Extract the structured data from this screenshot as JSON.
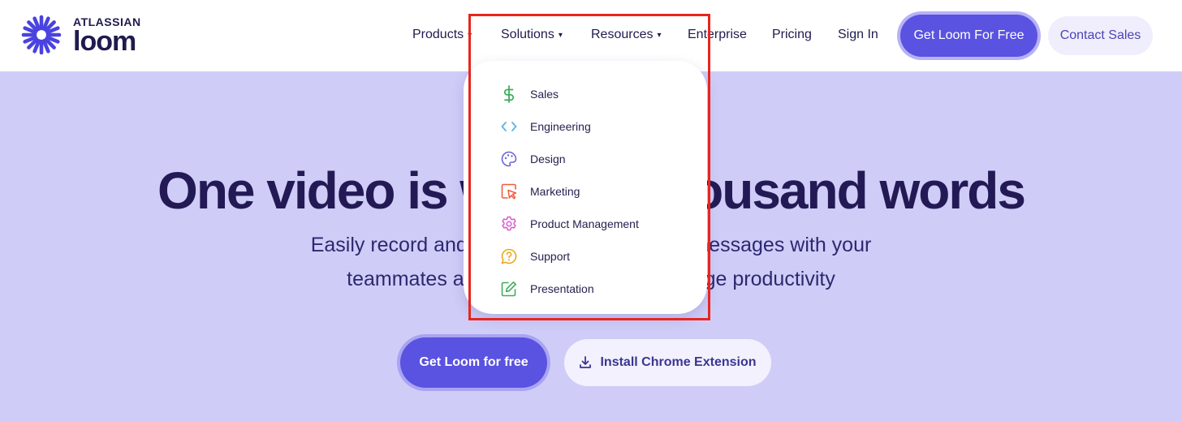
{
  "brand": {
    "atlassian": "ATLASSIAN",
    "name": "loom",
    "color": "#4a43e0"
  },
  "nav": {
    "products": "Products",
    "solutions": "Solutions",
    "resources": "Resources",
    "enterprise": "Enterprise",
    "pricing": "Pricing",
    "sign_in": "Sign In",
    "get_loom": "Get Loom For Free",
    "contact_sales": "Contact Sales",
    "caret": "▾"
  },
  "solutions_menu": {
    "items": [
      {
        "label": "Sales",
        "icon": "dollar-icon",
        "color": "#3fae5b"
      },
      {
        "label": "Engineering",
        "icon": "code-icon",
        "color": "#5ab4e6"
      },
      {
        "label": "Design",
        "icon": "palette-icon",
        "color": "#6b63d8"
      },
      {
        "label": "Marketing",
        "icon": "cursor-click-icon",
        "color": "#f05d3e"
      },
      {
        "label": "Product Management",
        "icon": "gear-icon",
        "color": "#d95ad0"
      },
      {
        "label": "Support",
        "icon": "question-bubble-icon",
        "color": "#e9a91c"
      },
      {
        "label": "Presentation",
        "icon": "edit-square-icon",
        "color": "#3fae5b"
      }
    ]
  },
  "hero": {
    "title": "One video is worth a thousand words",
    "subtitle_line1": "Easily record and share AI-powered video messages with your",
    "subtitle_line2": "teammates and customers to supercharge productivity",
    "primary_cta": "Get Loom for free",
    "secondary_cta": "Install Chrome Extension",
    "background": "#cfcdf7"
  }
}
